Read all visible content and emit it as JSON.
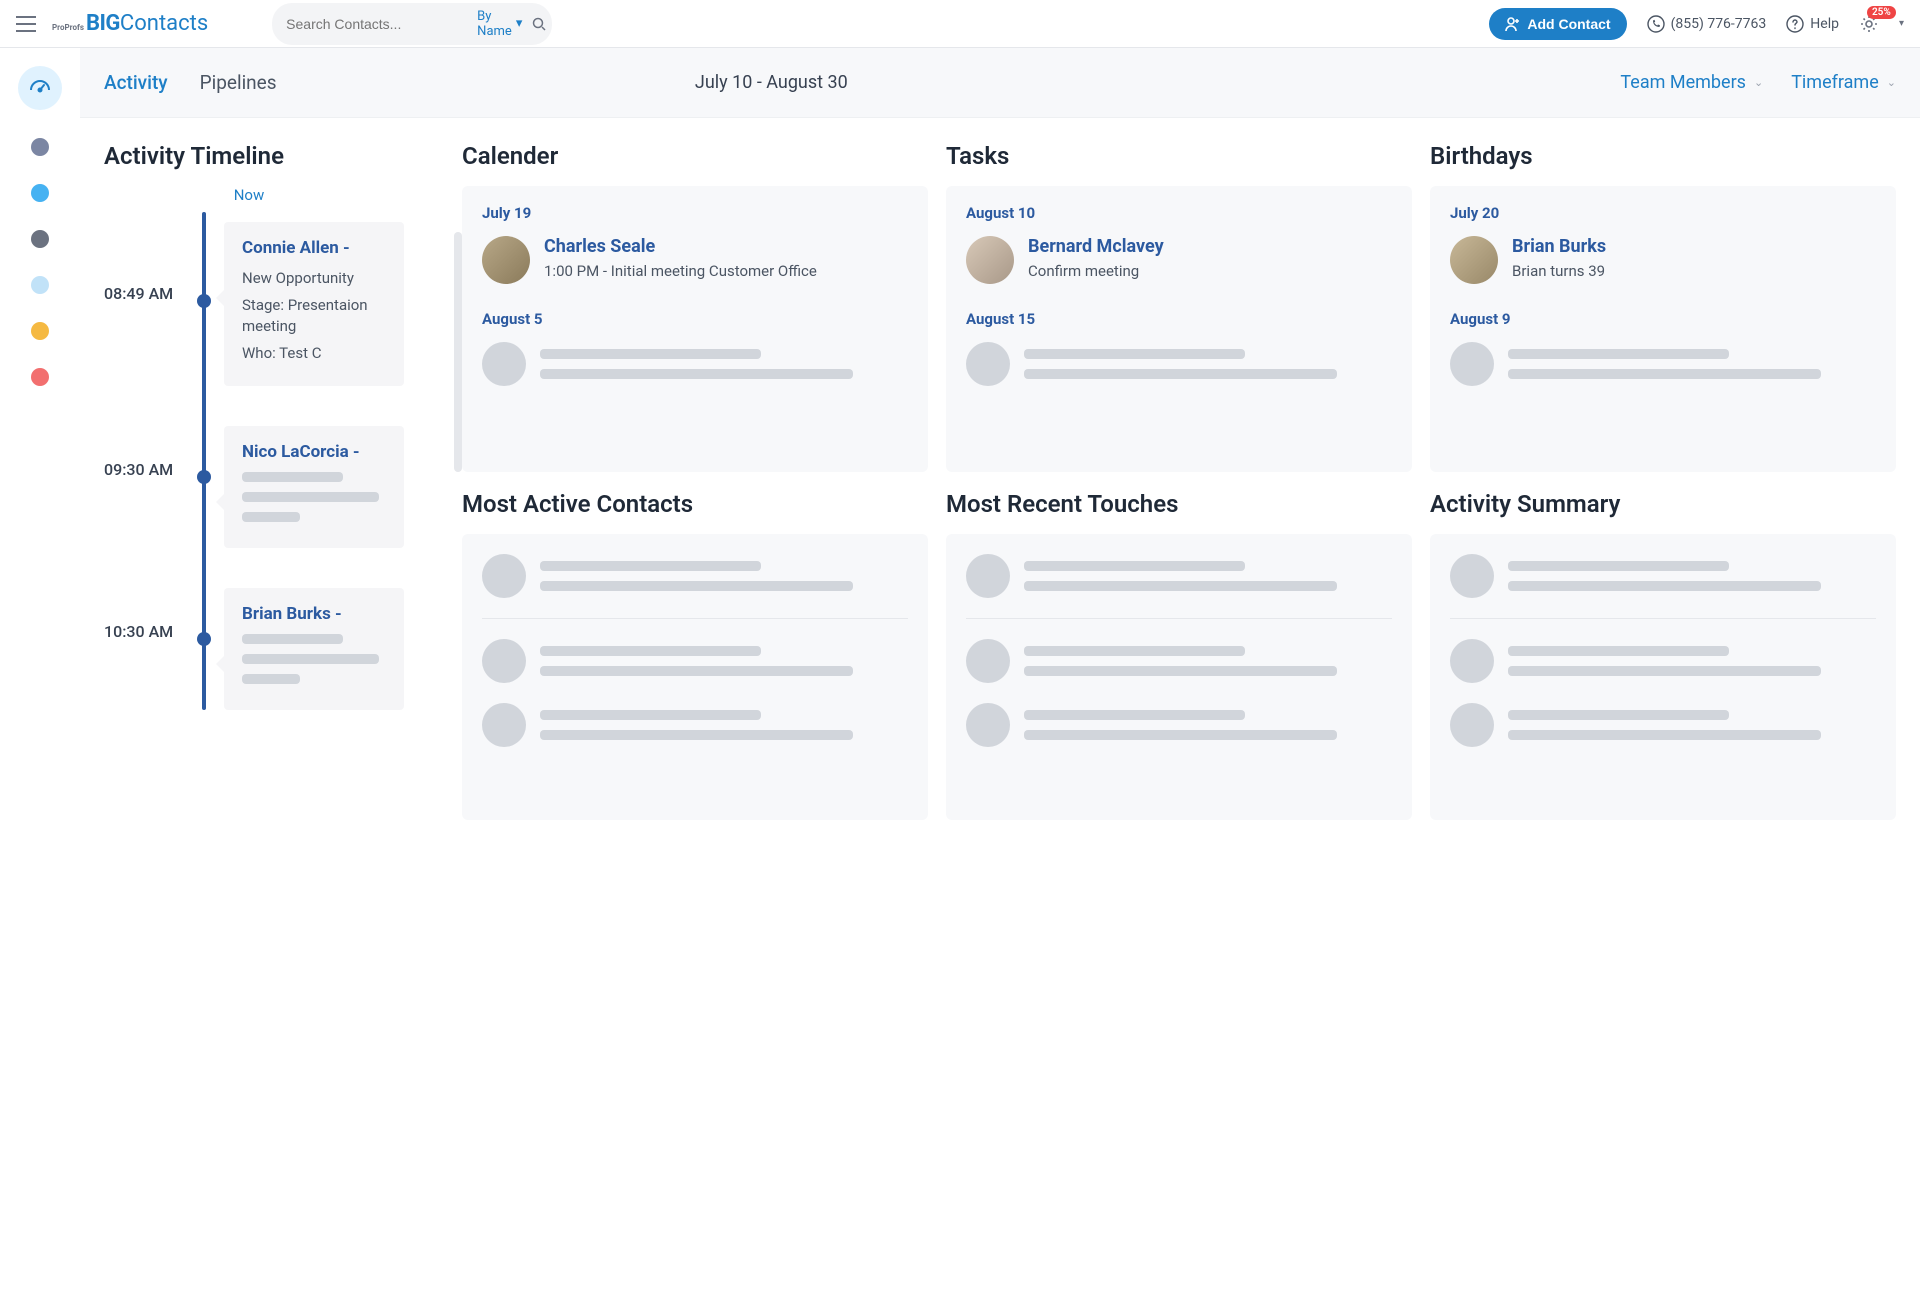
{
  "header": {
    "logo_sub": "ProProfs",
    "logo_big": "BIG",
    "logo_contacts": "Contacts",
    "search_placeholder": "Search Contacts...",
    "by_name": "By Name",
    "add_contact": "Add Contact",
    "phone": "(855) 776-7763",
    "help": "Help",
    "badge": "25%"
  },
  "sidebar_dots": [
    {
      "color": "#7b86a3"
    },
    {
      "color": "#46b2f2"
    },
    {
      "color": "#6b7280"
    },
    {
      "color": "#c1e2f8"
    },
    {
      "color": "#f5b942"
    },
    {
      "color": "#f26f6f"
    }
  ],
  "subheader": {
    "tabs": [
      {
        "label": "Activity",
        "active": true
      },
      {
        "label": "Pipelines",
        "active": false
      }
    ],
    "date_range": "July 10 - August 30",
    "dropdowns": [
      {
        "label": "Team Members"
      },
      {
        "label": "Timeframe"
      }
    ]
  },
  "timeline": {
    "title": "Activity Timeline",
    "now": "Now",
    "items": [
      {
        "time": "08:49 AM",
        "name": "Connie Allen -",
        "lines": [
          "New  Opportunity",
          "Stage: Presentaion meeting",
          "Who: Test C"
        ]
      },
      {
        "time": "09:30 AM",
        "name": "Nico LaCorcia -",
        "lines": []
      },
      {
        "time": "10:30 AM",
        "name": "Brian Burks -",
        "lines": []
      }
    ]
  },
  "sections": {
    "calendar": {
      "title": "Calender",
      "date1": "July 19",
      "person": {
        "name": "Charles Seale",
        "sub": "1:00 PM - Initial meeting Customer Office"
      },
      "date2": "August 5"
    },
    "tasks": {
      "title": "Tasks",
      "date1": "August 10",
      "person": {
        "name": "Bernard Mclavey",
        "sub": "Confirm meeting"
      },
      "date2": "August 15"
    },
    "birthdays": {
      "title": "Birthdays",
      "date1": "July 20",
      "person": {
        "name": "Brian Burks",
        "sub": "Brian turns 39"
      },
      "date2": "August 9"
    },
    "mac": {
      "title": "Most Active Contacts"
    },
    "mrt": {
      "title": "Most Recent Touches"
    },
    "asm": {
      "title": "Activity Summary"
    }
  }
}
